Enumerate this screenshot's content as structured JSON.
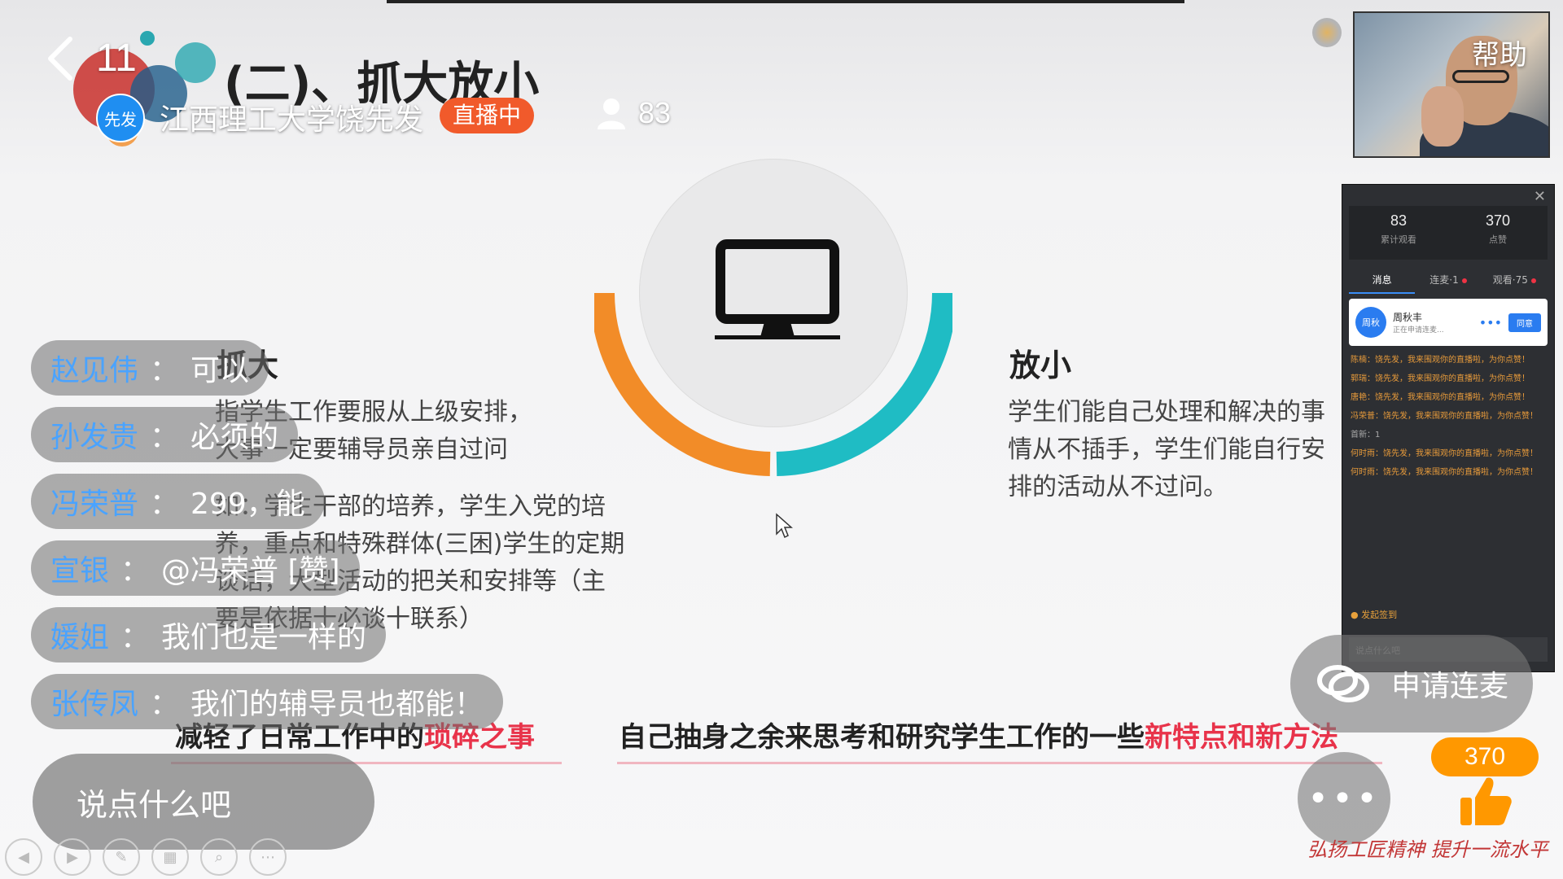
{
  "header": {
    "page_counter": "11",
    "slide_title": "(二)、抓大放小",
    "host_avatar_text": "先发",
    "host_name": "江西理工大学饶先发",
    "live_badge": "直播中",
    "viewer_count": "83",
    "help_label": "帮助"
  },
  "slide": {
    "left_heading": "抓大",
    "left_text": [
      "指学生工作要服从上级安排，",
      "大事一定要辅导员亲自过问",
      "如：学生干部的培养，学生入党的培",
      "养，重点和特殊群体(三困)学生的定期",
      "谈话，大型活动的把关和安排等（主",
      "要是依据十必谈十联系）"
    ],
    "right_heading": "放小",
    "right_text": [
      "学生们能自己处理和解决的事",
      "情从不插手，学生们能自行安",
      "排的活动从不过问。"
    ],
    "bottom_left_prefix": "减轻了日常工作中的",
    "bottom_left_highlight": "琐碎之事",
    "bottom_right_prefix": "自己抽身之余来思考和研究学生工作的一些",
    "bottom_right_highlight": "新特点和新方法",
    "colors": {
      "left_arc": "#f28c28",
      "right_arc": "#1fbcc4",
      "highlight": "#e8334a"
    }
  },
  "comments": [
    {
      "name": "赵见伟",
      "text": "可以"
    },
    {
      "name": "孙发贵",
      "text": "必须的"
    },
    {
      "name": "冯荣普",
      "text": "299，能"
    },
    {
      "name": "宣银",
      "text": "@冯荣普 [赞]"
    },
    {
      "name": "媛姐",
      "text": "我们也是一样的"
    },
    {
      "name": "张传凤",
      "text": "我们的辅导员也都能！"
    }
  ],
  "comment_separator": "：",
  "input": {
    "placeholder": "说点什么吧"
  },
  "chat_panel": {
    "stats": [
      {
        "value": "83",
        "label": "累计观看"
      },
      {
        "value": "370",
        "label": "点赞"
      }
    ],
    "tabs": [
      "消息",
      "连麦·1",
      "观看·75"
    ],
    "card": {
      "avatar": "周秋",
      "name": "周秋丰",
      "sub": "正在申请连麦...",
      "reply": "同意"
    },
    "messages": [
      "陈楠：饶先发，我来围观你的直播啦，为你点赞！",
      "郭瑞：饶先发，我来围观你的直播啦，为你点赞！",
      "唐艳：饶先发，我来围观你的直播啦，为你点赞！",
      "冯荣普：饶先发，我来围观你的直播啦，为你点赞！",
      "首新：1",
      "何时雨：饶先发，我来围观你的直播啦，为你点赞！",
      "何时雨：饶先发，我来围观你的直播啦，为你点赞！"
    ],
    "sign_label": "发起签到",
    "input_placeholder": "说点什么吧"
  },
  "actions": {
    "connect_label": "申请连麦",
    "more_label": "•••",
    "like_count": "370"
  },
  "signature": "弘扬工匠精神 提升一流水平"
}
